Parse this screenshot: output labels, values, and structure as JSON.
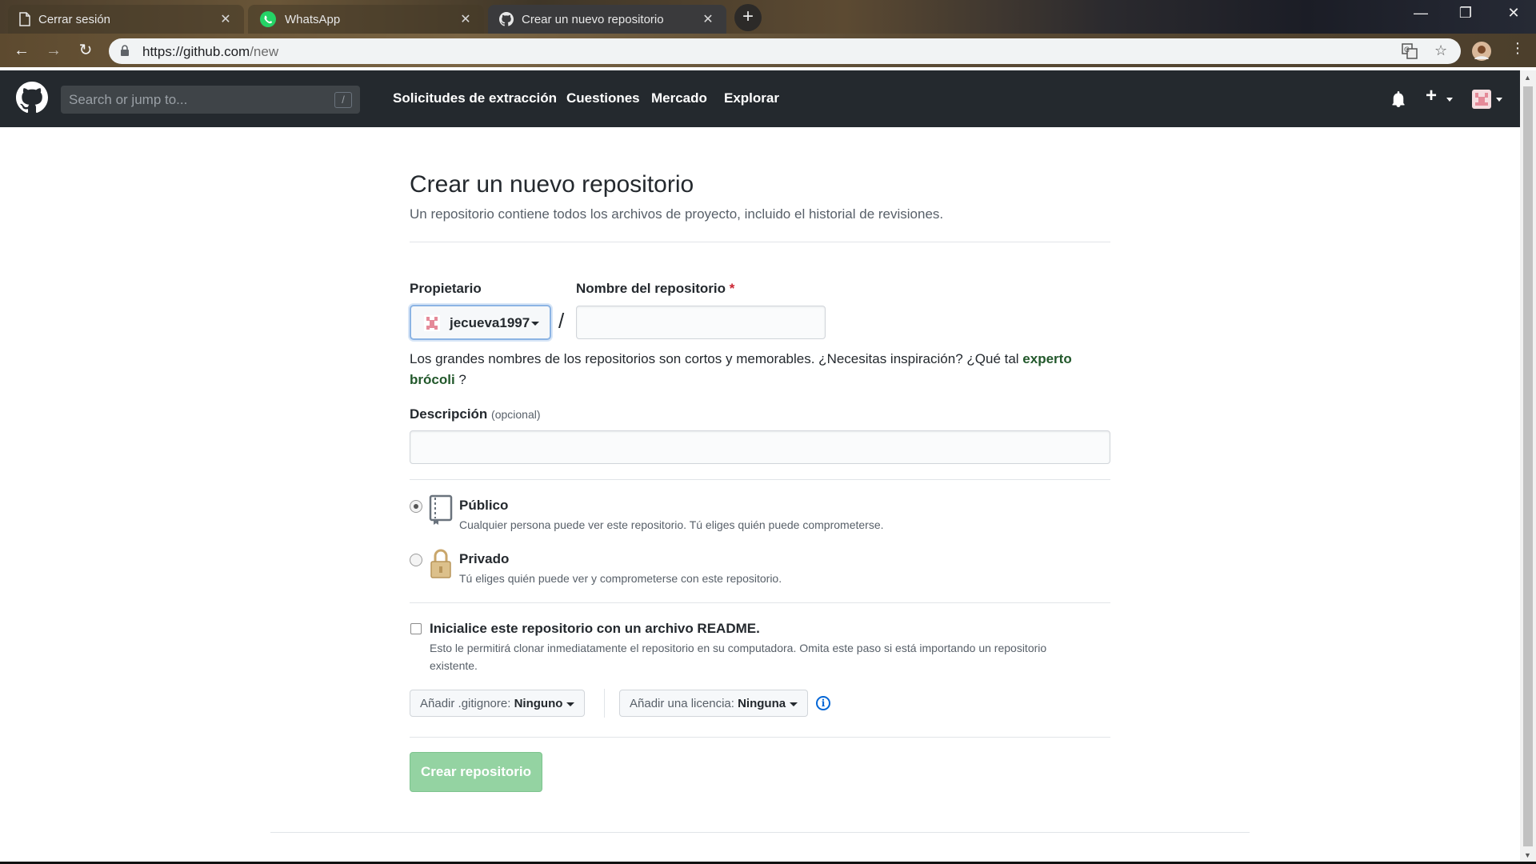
{
  "browser": {
    "tabs": [
      {
        "title": "Cerrar sesión",
        "icon": "page-icon"
      },
      {
        "title": "WhatsApp",
        "icon": "whatsapp-icon"
      },
      {
        "title": "Crear un nuevo repositorio",
        "icon": "github-icon",
        "active": true
      }
    ],
    "url_host": "https://github.com",
    "url_path": "/new"
  },
  "header": {
    "search_placeholder": "Search or jump to...",
    "search_shortcut": "/",
    "nav": [
      "Solicitudes de extracción",
      "Cuestiones",
      "Mercado",
      "Explorar"
    ],
    "plus": "+"
  },
  "page": {
    "title": "Crear un nuevo repositorio",
    "subtitle": "Un repositorio contiene todos los archivos de proyecto, incluido el historial de revisiones.",
    "owner_label": "Propietario",
    "owner_value": "jecueva1997",
    "separator": "/",
    "repo_name_label": "Nombre del repositorio",
    "required_mark": "*",
    "repo_name_value": "",
    "hint_text": "Los grandes nombres de los repositorios son cortos y memorables. ¿Necesitas inspiración? ¿Qué tal ",
    "hint_suggestion_1": "experto",
    "hint_suggestion_2": "brócoli",
    "hint_end": " ?",
    "description_label": "Descripción",
    "description_optional": "(opcional)",
    "description_value": "",
    "visibility": [
      {
        "title": "Público",
        "desc": "Cualquier persona puede ver este repositorio. Tú eliges quién puede comprometerse.",
        "checked": true
      },
      {
        "title": "Privado",
        "desc": "Tú eliges quién puede ver y comprometerse con este repositorio.",
        "checked": false
      }
    ],
    "readme_title": "Inicialice este repositorio con un archivo README.",
    "readme_desc_1": "Esto le permitirá clonar inmediatamente el repositorio en su computadora. Omita este paso si está importando un repositorio",
    "readme_desc_2": "existente.",
    "readme_checked": false,
    "gitignore_label": "Añadir .gitignore:",
    "gitignore_value": "Ninguno",
    "license_label": "Añadir una licencia:",
    "license_value": "Ninguna",
    "info_icon": "i",
    "create_button": "Crear repositorio"
  },
  "colors": {
    "header_bg": "#24292e",
    "create_button_bg": "#94d3a2",
    "suggestion": "#22582b",
    "required": "#cb2431"
  }
}
